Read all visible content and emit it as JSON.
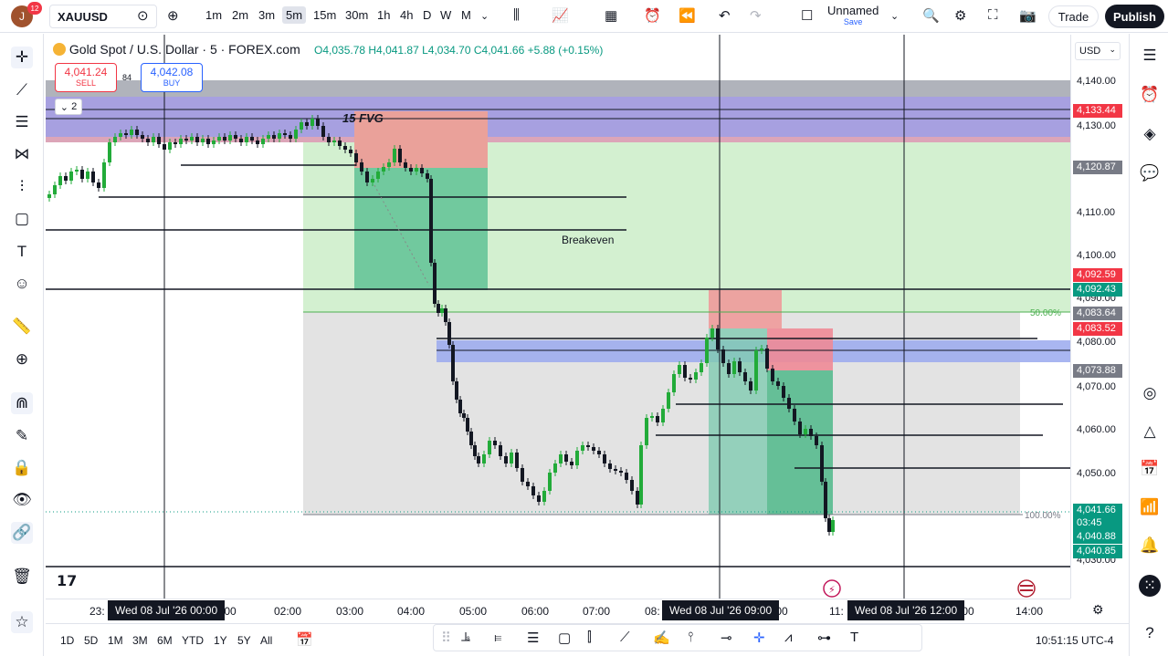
{
  "header": {
    "avatar_letter": "J",
    "notification_count": "12",
    "symbol": "XAUUSD",
    "intervals": [
      "1m",
      "2m",
      "3m",
      "5m",
      "15m",
      "30m",
      "1h",
      "4h",
      "D",
      "W",
      "M"
    ],
    "active_interval": "5m",
    "layout_name": "Unnamed",
    "layout_status": "Save",
    "trade_label": "Trade",
    "publish_label": "Publish"
  },
  "legend": {
    "title": "Gold Spot / U.S. Dollar · 5 · FOREX.com",
    "open": "O4,035.78",
    "high": "H4,041.87",
    "low": "L4,034.70",
    "close": "C4,041.66",
    "change": "+5.88 (+0.15%)",
    "sell_price": "4,041.24",
    "sell_label": "SELL",
    "spread": "84",
    "buy_price": "4,042.08",
    "buy_label": "BUY",
    "collapse_count": "2"
  },
  "chart_annotations": {
    "fvg_label": "15 FVG",
    "breakeven_label": "Breakeven",
    "fib_50": "50.00%",
    "fib_100": "100.00%"
  },
  "price_axis": {
    "currency": "USD",
    "labels": [
      "4,140.00",
      "4,130.00",
      "4,110.00",
      "4,100.00",
      "4,090.00",
      "4,080.00",
      "4,070.00",
      "4,060.00",
      "4,050.00",
      "4,030.00"
    ],
    "tags": [
      {
        "value": "4,133.44",
        "color": "#f23645"
      },
      {
        "value": "4,120.87",
        "color": "#787b86"
      },
      {
        "value": "4,092.59",
        "color": "#f23645"
      },
      {
        "value": "4,092.43",
        "color": "#089981"
      },
      {
        "value": "4,083.64",
        "color": "#787b86"
      },
      {
        "value": "4,083.52",
        "color": "#f23645"
      },
      {
        "value": "4,073.88",
        "color": "#787b86"
      },
      {
        "value": "4,041.66",
        "color": "#089981"
      },
      {
        "value": "03:45",
        "color": "#089981"
      },
      {
        "value": "4,040.88",
        "color": "#089981"
      },
      {
        "value": "4,040.85",
        "color": "#089981"
      }
    ]
  },
  "time_axis": {
    "labels": [
      "23:",
      ":00",
      "02:00",
      "03:00",
      "04:00",
      "05:00",
      "06:00",
      "07:00",
      "08:",
      ":00",
      "11:",
      ":00",
      "14:00"
    ],
    "tags": [
      "Wed 08 Jul '26   00:00",
      "Wed 08 Jul '26   09:00",
      "Wed 08 Jul '26   12:00"
    ]
  },
  "bottom": {
    "ranges": [
      "1D",
      "5D",
      "1M",
      "3M",
      "6M",
      "YTD",
      "1Y",
      "5Y",
      "All"
    ],
    "clock": "10:51:15 UTC-4"
  },
  "colors": {
    "up": "#089981",
    "down": "#131722",
    "candle_up": "#22ab39",
    "accent": "#2962ff",
    "sell": "#f23645"
  }
}
